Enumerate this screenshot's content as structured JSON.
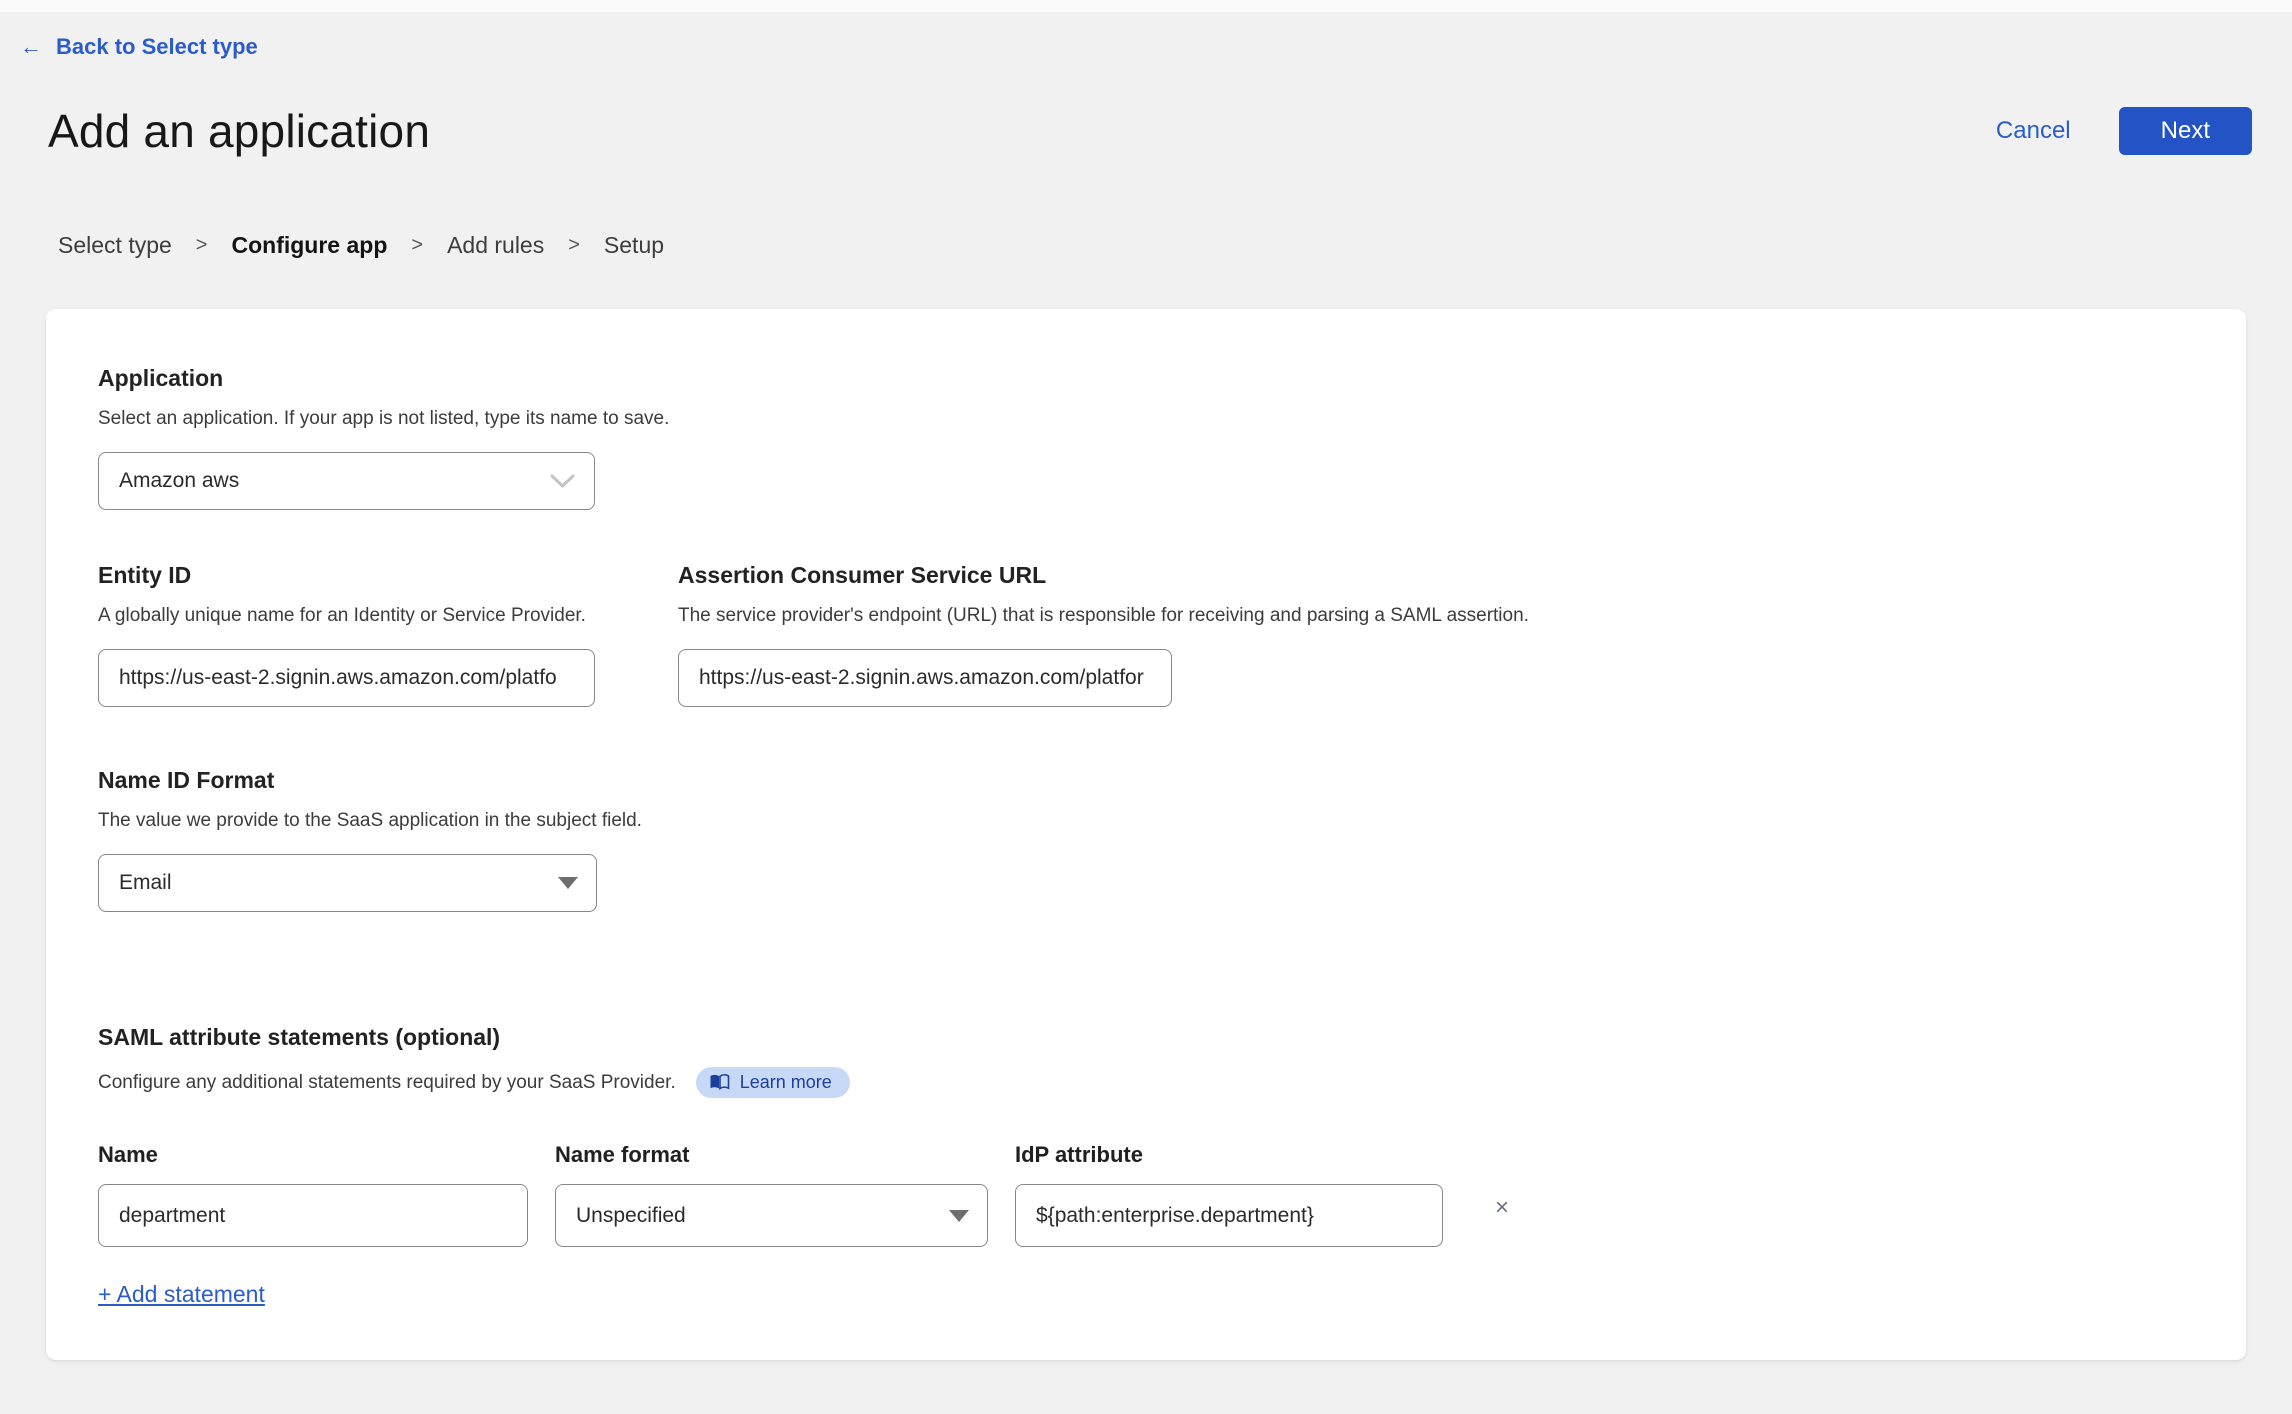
{
  "page": {
    "back_link": {
      "arrow": "←",
      "label": "Back to Select type"
    },
    "title": "Add an application",
    "actions": {
      "cancel": "Cancel",
      "next": "Next"
    }
  },
  "breadcrumb": {
    "separator": ">",
    "items": [
      {
        "label": "Select type",
        "active": false
      },
      {
        "label": "Configure app",
        "active": true
      },
      {
        "label": "Add rules",
        "active": false
      },
      {
        "label": "Setup",
        "active": false
      }
    ]
  },
  "form": {
    "application": {
      "label": "Application",
      "description": "Select an application. If your app is not listed, type its name to save.",
      "value": "Amazon aws"
    },
    "entity_id": {
      "label": "Entity ID",
      "description": "A globally unique name for an Identity or Service Provider.",
      "value": "https://us-east-2.signin.aws.amazon.com/platfo"
    },
    "acs_url": {
      "label": "Assertion Consumer Service URL",
      "description": "The service provider's endpoint (URL) that is responsible for receiving and parsing a SAML assertion.",
      "value": "https://us-east-2.signin.aws.amazon.com/platfor"
    },
    "name_id_format": {
      "label": "Name ID Format",
      "description": "The value we provide to the SaaS application in the subject field.",
      "value": "Email"
    },
    "saml_attributes": {
      "label": "SAML attribute statements (optional)",
      "description": "Configure any additional statements required by your SaaS Provider.",
      "learn_more": "Learn more",
      "statement": {
        "name_label": "Name",
        "name_value": "department",
        "format_label": "Name format",
        "format_value": "Unspecified",
        "idp_label": "IdP attribute",
        "idp_value": "${path:enterprise.department}",
        "remove": "×"
      },
      "add_statement": "+ Add statement"
    }
  },
  "colors": {
    "accent_blue": "#2353c5",
    "link_blue": "#2b5cc9",
    "pill_bg": "#c8d9f7",
    "pill_text": "#1c3f9c",
    "page_bg": "#f1f1f2",
    "card_bg": "#ffffff"
  }
}
